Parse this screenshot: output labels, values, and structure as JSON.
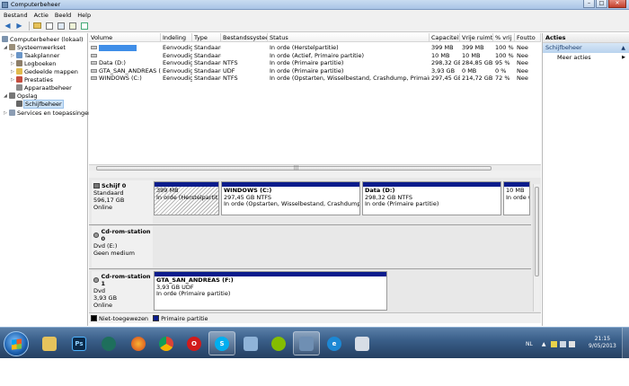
{
  "window": {
    "title": "Computerbeheer",
    "buttons": {
      "minimize": "–",
      "maximize": "□",
      "close": "✕"
    }
  },
  "menu": [
    "Bestand",
    "Actie",
    "Beeld",
    "Help"
  ],
  "tree": {
    "root": "Computerbeheer (lokaal)",
    "systemtools": "Systeemwerkset",
    "taakplanner": "Taakplanner",
    "logboeken": "Logboeken",
    "gedeelde_mappen": "Gedeelde mappen",
    "prestaties": "Prestaties",
    "apparaatbeheer": "Apparaatbeheer",
    "opslag": "Opslag",
    "schijfbeheer": "Schijfbeheer",
    "services": "Services en toepassingen"
  },
  "volume_table": {
    "headers": [
      "Volume",
      "Indeling",
      "Type",
      "Bestandssysteem",
      "Status",
      "Capaciteit",
      "Vrije ruimte",
      "% vrij",
      "Foutto"
    ],
    "rows": [
      {
        "volume": "",
        "indeling": "Eenvoudig",
        "type": "Standaard",
        "fs": "",
        "status": "In orde (Herstelpartitie)",
        "cap": "399 MB",
        "vrij": "399 MB",
        "pct": "100 %",
        "fout": "Nee"
      },
      {
        "volume": "",
        "indeling": "Eenvoudig",
        "type": "Standaard",
        "fs": "",
        "status": "In orde (Actief, Primaire partitie)",
        "cap": "10 MB",
        "vrij": "10 MB",
        "pct": "100 %",
        "fout": "Nee"
      },
      {
        "volume": "Data (D:)",
        "indeling": "Eenvoudig",
        "type": "Standaard",
        "fs": "NTFS",
        "status": "In orde (Primaire partitie)",
        "cap": "298,32 GB",
        "vrij": "284,85 GB",
        "pct": "95 %",
        "fout": "Nee"
      },
      {
        "volume": "GTA_SAN_ANDREAS (F:)",
        "indeling": "Eenvoudig",
        "type": "Standaard",
        "fs": "UDF",
        "status": "In orde (Primaire partitie)",
        "cap": "3,93 GB",
        "vrij": "0 MB",
        "pct": "0 %",
        "fout": "Nee"
      },
      {
        "volume": "WINDOWS (C:)",
        "indeling": "Eenvoudig",
        "type": "Standaard",
        "fs": "NTFS",
        "status": "In orde (Opstarten, Wisselbestand, Crashdump, Primaire partitie)",
        "cap": "297,45 GB",
        "vrij": "214,72 GB",
        "pct": "72 %",
        "fout": "Nee"
      }
    ]
  },
  "disks": [
    {
      "name": "Schijf 0",
      "type": "Standaard",
      "size": "596,17 GB",
      "state": "Online",
      "partitions": [
        {
          "title": "",
          "size": "399 MB",
          "status": "In orde (Herstelpartitie)"
        },
        {
          "title": "WINDOWS  (C:)",
          "size": "297,45 GB NTFS",
          "status": "In orde (Opstarten, Wisselbestand, Crashdump, Primair"
        },
        {
          "title": "Data  (D:)",
          "size": "298,32 GB NTFS",
          "status": "In orde (Primaire partitie)"
        },
        {
          "title": "",
          "size": "10 MB",
          "status": "In orde ("
        }
      ]
    },
    {
      "name": "Cd-rom-station 0",
      "type": "Dvd (E:)",
      "size": "",
      "state": "Geen medium"
    },
    {
      "name": "Cd-rom-station 1",
      "type": "Dvd",
      "size": "3,93 GB",
      "state": "Online",
      "partitions": [
        {
          "title": "GTA_SAN_ANDREAS  (F:)",
          "size": "3,93 GB UDF",
          "status": "In orde (Primaire partitie)"
        }
      ]
    }
  ],
  "legend": {
    "unallocated": "Niet-toegewezen",
    "primary": "Primaire partitie"
  },
  "actions": {
    "header": "Acties",
    "section": "Schijfbeheer",
    "more": "Meer acties"
  },
  "taskbar": {
    "apps": [
      "explorer-icon",
      "photoshop-icon",
      "media-center-icon",
      "firefox-icon",
      "chrome-icon",
      "opera-icon",
      "skype-icon",
      "network-icon",
      "spotify-icon",
      "computer-management-icon",
      "internet-explorer-icon",
      "paint-icon"
    ],
    "lang": "NL",
    "time": "21:15",
    "date": "9/05/2013"
  },
  "colors": {
    "primary_partition": "#0b1c8c",
    "unallocated": "#000000",
    "selection": "#cde3f7"
  }
}
